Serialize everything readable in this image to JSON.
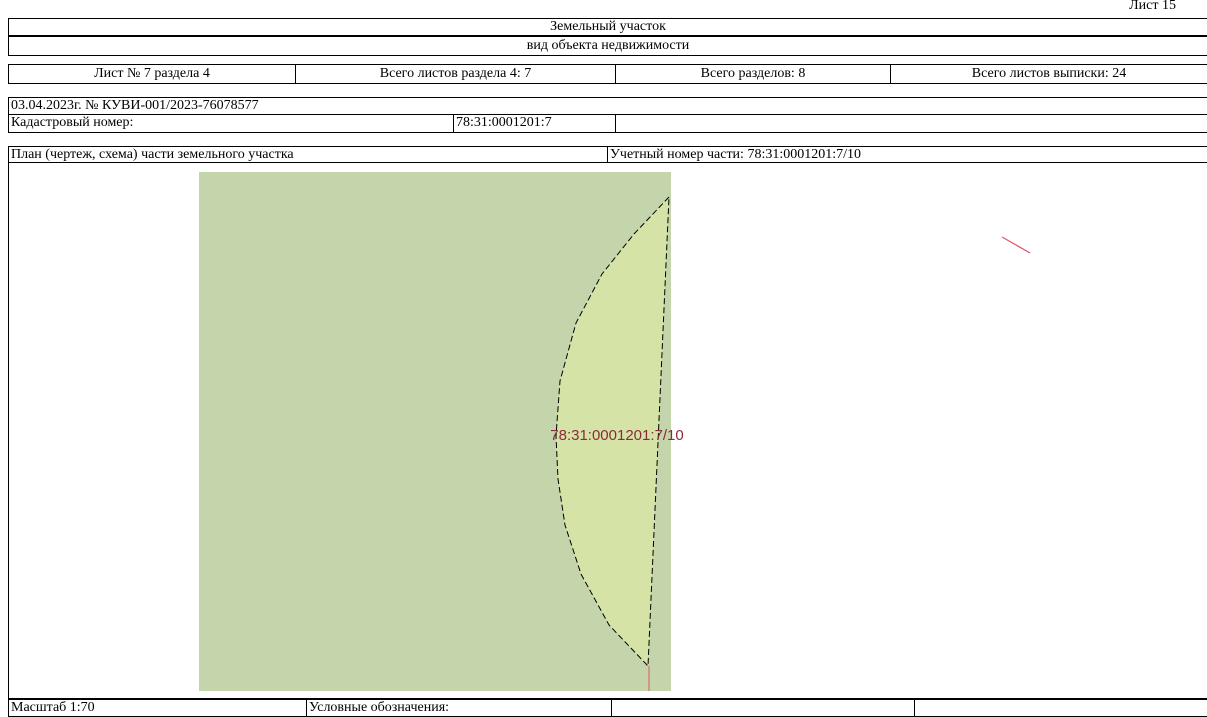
{
  "sheet_label": "Лист 15",
  "header": {
    "object_title": "Земельный участок",
    "object_subtitle": "вид объекта недвижимости"
  },
  "sheet_info": {
    "sheet_number": "Лист № 7 раздела 4",
    "section_sheets_total": "Всего листов раздела 4: 7",
    "sections_total": "Всего разделов: 8",
    "extract_sheets_total": "Всего листов выписки: 24"
  },
  "document_ref": "03.04.2023г. № КУВИ-001/2023-76078577",
  "cadastral": {
    "label": "Кадастровый номер:",
    "value": "78:31:0001201:7"
  },
  "plan": {
    "title": "План (чертеж, схема) части земельного участка",
    "part_number": "Учетный номер части: 78:31:0001201:7/10",
    "map_label": "78:31:0001201:7/10",
    "colors": {
      "parcel_fill": "#c5d5ab",
      "part_fill": "#d5e4a6",
      "label_color": "#8b2a3c",
      "marker_color": "#e0556a"
    }
  },
  "footer": {
    "scale": "Масштаб 1:70",
    "legend_label": "Условные обозначения:"
  }
}
